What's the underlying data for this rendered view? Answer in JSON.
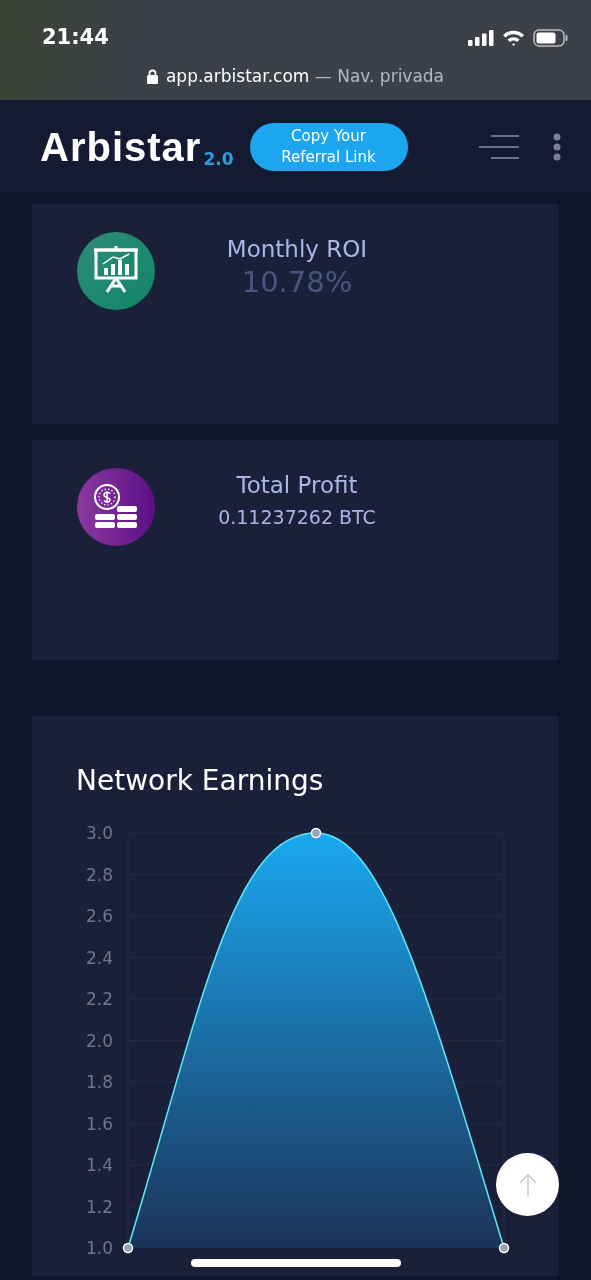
{
  "status_bar": {
    "time": "21:44"
  },
  "address_bar": {
    "url": "app.arbistar.com",
    "mode": " — Nav. privada"
  },
  "header": {
    "logo": "Arbistar",
    "logo_version": "2.0",
    "referral_button": "Copy Your Referral Link"
  },
  "stats": [
    {
      "kind": "roi",
      "title": "Monthly ROI",
      "value": "10.78%"
    },
    {
      "kind": "profit",
      "title": "Total Profit",
      "value": "0.11237262 BTC"
    }
  ],
  "earnings": {
    "chart_data": {
      "type": "area",
      "title": "Network Earnings",
      "grid": true,
      "series": [
        {
          "color": "#5ee8f5",
          "values": [
            1,
            3,
            1
          ]
        }
      ],
      "ylim": [
        1,
        3
      ],
      "yticks": [
        {
          "value": 1,
          "label": "1.0"
        },
        {
          "value": 1.2,
          "label": "1.2"
        },
        {
          "value": 1.4,
          "label": "1.4"
        },
        {
          "value": 1.6,
          "label": "1.6"
        },
        {
          "value": 1.8,
          "label": "1.8"
        },
        {
          "value": 2,
          "label": "2.0"
        },
        {
          "value": 2.2,
          "label": "2.2"
        },
        {
          "value": 2.4,
          "label": "2.4"
        },
        {
          "value": 2.6,
          "label": "2.6"
        },
        {
          "value": 2.8,
          "label": "2.8"
        },
        {
          "value": 3,
          "label": "3.0"
        }
      ]
    }
  }
}
